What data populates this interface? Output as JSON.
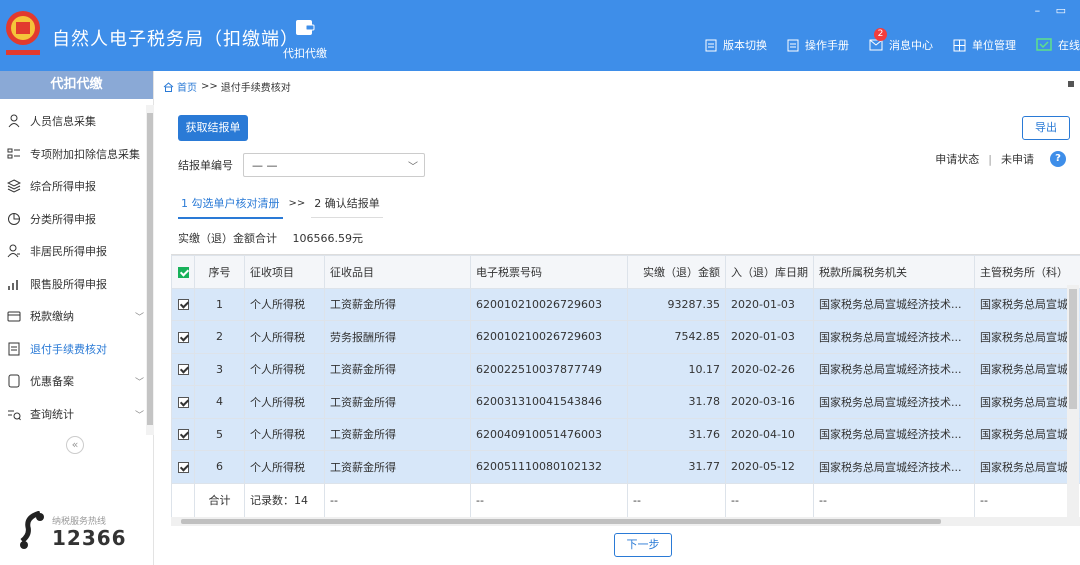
{
  "app": {
    "title": "自然人电子税务局（扣缴端）",
    "module_label": "代扣代缴"
  },
  "top_actions": [
    {
      "label": "版本切换",
      "icon": "document-icon"
    },
    {
      "label": "操作手册",
      "icon": "manual-icon"
    },
    {
      "label": "消息中心",
      "icon": "mail-icon",
      "badge": "2"
    },
    {
      "label": "单位管理",
      "icon": "building-icon"
    },
    {
      "label": "在线",
      "icon": "online-check-icon"
    }
  ],
  "window_controls": "– ▭",
  "sidebar": {
    "header": "代扣代缴",
    "items": [
      {
        "label": "人员信息采集",
        "icon": "person-icon"
      },
      {
        "label": "专项附加扣除信息采集",
        "icon": "list-icon"
      },
      {
        "label": "综合所得申报",
        "icon": "layers-icon"
      },
      {
        "label": "分类所得申报",
        "icon": "pie-icon"
      },
      {
        "label": "非居民所得申报",
        "icon": "person-outline-icon"
      },
      {
        "label": "限售股所得申报",
        "icon": "bar-chart-icon"
      },
      {
        "label": "税款缴纳",
        "icon": "wallet-icon",
        "chevron": "﹀"
      },
      {
        "label": "退付手续费核对",
        "icon": "form-icon"
      },
      {
        "label": "优惠备案",
        "icon": "file-icon",
        "chevron": "﹀"
      },
      {
        "label": "查询统计",
        "icon": "query-icon",
        "chevron": "﹀"
      }
    ],
    "collapse_symbol": "«",
    "hotline_label": "纳税服务热线",
    "hotline_number": "12366"
  },
  "breadcrumb": {
    "home": "首页",
    "separator": ">>",
    "current": "退付手续费核对"
  },
  "buttons": {
    "fetch": "获取结报单",
    "export": "导出",
    "next": "下一步"
  },
  "form": {
    "label": "结报单编号",
    "value": "— —"
  },
  "status": {
    "label": "申请状态",
    "separator": "|",
    "value": "未申请",
    "help": "?"
  },
  "steps": [
    {
      "label": "1 勾选单户核对清册"
    },
    {
      "label": "2 确认结报单"
    }
  ],
  "step_arrow": ">>",
  "total": {
    "label": "实缴（退）金额合计",
    "value": "106566.59元"
  },
  "table": {
    "columns": [
      "序号",
      "征收项目",
      "征收品目",
      "电子税票号码",
      "实缴（退）金额",
      "入（退）库日期",
      "税款所属税务机关",
      "主管税务所（科）"
    ],
    "rows": [
      [
        "1",
        "个人所得税",
        "工资薪金所得",
        "620010210026729603",
        "93287.35",
        "2020-01-03",
        "国家税务总局宣城经济技术...",
        "国家税务总局宣城"
      ],
      [
        "2",
        "个人所得税",
        "劳务报酬所得",
        "620010210026729603",
        "7542.85",
        "2020-01-03",
        "国家税务总局宣城经济技术...",
        "国家税务总局宣城"
      ],
      [
        "3",
        "个人所得税",
        "工资薪金所得",
        "620022510037877749",
        "10.17",
        "2020-02-26",
        "国家税务总局宣城经济技术...",
        "国家税务总局宣城"
      ],
      [
        "4",
        "个人所得税",
        "工资薪金所得",
        "620031310041543846",
        "31.78",
        "2020-03-16",
        "国家税务总局宣城经济技术...",
        "国家税务总局宣城"
      ],
      [
        "5",
        "个人所得税",
        "工资薪金所得",
        "620040910051476003",
        "31.76",
        "2020-04-10",
        "国家税务总局宣城经济技术...",
        "国家税务总局宣城"
      ],
      [
        "6",
        "个人所得税",
        "工资薪金所得",
        "620051110080102132",
        "31.77",
        "2020-05-12",
        "国家税务总局宣城经济技术...",
        "国家税务总局宣城"
      ]
    ],
    "footer": {
      "label": "合计",
      "record_count": "记录数：14",
      "placeholder": "--"
    }
  },
  "colors": {
    "topbar": "#3e8ee9",
    "accent": "#2a7ad6",
    "selected_row": "#d7e7f9",
    "badge": "#f23d3d"
  }
}
